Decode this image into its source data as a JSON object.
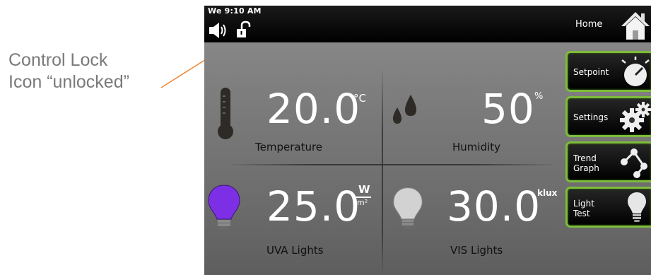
{
  "annotation": {
    "line1": "Control Lock",
    "line2": "Icon “unlocked”"
  },
  "status_bar": {
    "datetime": "We 9:10 AM",
    "home_label": "Home"
  },
  "readings": {
    "temperature": {
      "value": "20.0",
      "unit": "°C",
      "label": "Temperature"
    },
    "humidity": {
      "value": "50",
      "unit": "%",
      "label": "Humidity"
    },
    "uva": {
      "value": "25.0",
      "unit_top": "W",
      "unit_bottom": "m²",
      "label": "UVA Lights",
      "bulb_color": "#7d2fe6"
    },
    "vis": {
      "value": "30.0",
      "unit": "klux",
      "label": "VIS Lights",
      "bulb_color": "#d2d2d2"
    }
  },
  "side_menu": {
    "setpoint": "Setpoint",
    "settings": "Settings",
    "trend_graph": "Trend\nGraph",
    "light_test": "Light\nTest"
  },
  "colors": {
    "button_border": "#7dbd3a",
    "annotation_arrow": "#f0883a"
  }
}
